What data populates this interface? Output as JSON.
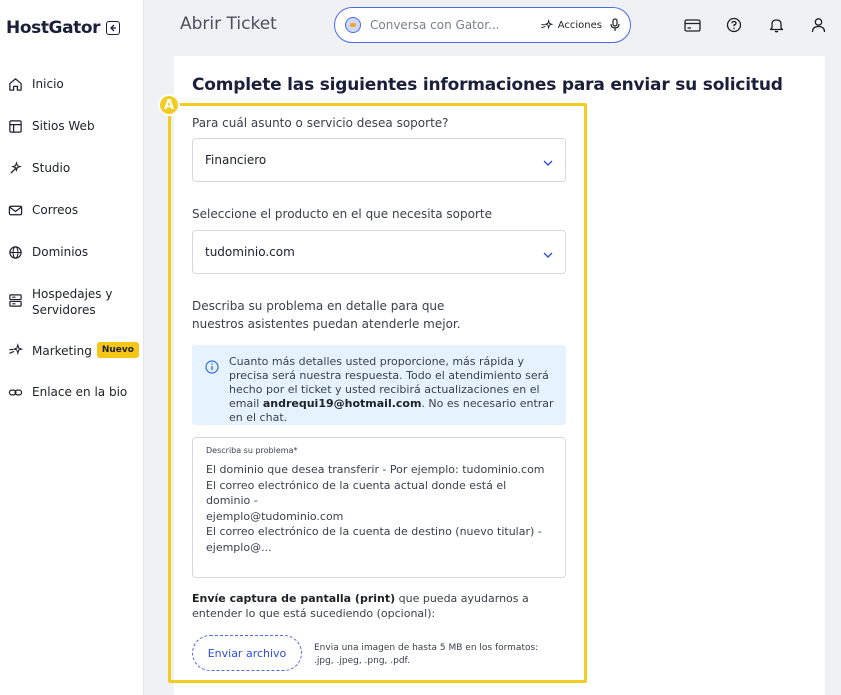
{
  "brand": {
    "name": "HostGator"
  },
  "sidebar": {
    "items": [
      {
        "label": "Inicio",
        "icon": "home-icon"
      },
      {
        "label": "Sitios Web",
        "icon": "browser-icon"
      },
      {
        "label": "Studio",
        "icon": "studio-icon"
      },
      {
        "label": "Correos",
        "icon": "mail-icon"
      },
      {
        "label": "Dominios",
        "icon": "globe-icon"
      },
      {
        "label": "Hospedajes y Servidores",
        "icon": "server-icon"
      },
      {
        "label": "Marketing",
        "icon": "sparkle-icon",
        "badge": "Nuevo"
      },
      {
        "label": "Enlace en la bio",
        "icon": "link-icon"
      }
    ]
  },
  "header": {
    "title": "Abrir Ticket",
    "search_placeholder": "Conversa con Gator...",
    "actions_label": "Acciones"
  },
  "form": {
    "title": "Complete las siguientes informaciones para enviar su solicitud",
    "highlight_marker": "A",
    "subject_label": "Para cuál asunto o servicio desea soporte?",
    "subject_value": "Financiero",
    "product_label": "Seleccione el producto en el que necesita soporte",
    "product_value": "tudominio.com",
    "describe_line1": "Describa su problema en detalle para que",
    "describe_line2": "nuestros asistentes puedan atenderle mejor.",
    "info_text_pre": "Cuanto más detalles usted proporcione, más rápida y precisa será nuestra respuesta. Todo el atendimiento será hecho por el ticket y usted recibirá actualizaciones en el email ",
    "info_email": "andrequi19@hotmail.com",
    "info_text_post": ". No es necesario entrar en el chat.",
    "textarea_label": "Describa su problema*",
    "textarea_line1": "El dominio que desea transferir - Por ejemplo: tudominio.com",
    "textarea_line2": "El correo electrónico de la cuenta actual donde está el dominio -",
    "textarea_line3": "ejemplo@tudominio.com",
    "textarea_line4": "El correo electrónico de la cuenta de destino (nuevo titular) -",
    "textarea_line5": "ejemplo@...",
    "upload_bold": "Envíe captura de pantalla (print)",
    "upload_rest": " que pueda ayudarnos a entender lo que está sucediendo (opcional):",
    "upload_button": "Enviar archivo",
    "upload_note_line1": "Envia una imagen de hasta 5 MB en los formatos:",
    "upload_note_line2": ".jpg, .jpeg, .png, .pdf."
  },
  "colors": {
    "highlight": "#f2cc22",
    "accent": "#4c6ae8",
    "info_bg": "#e6f2fd"
  }
}
